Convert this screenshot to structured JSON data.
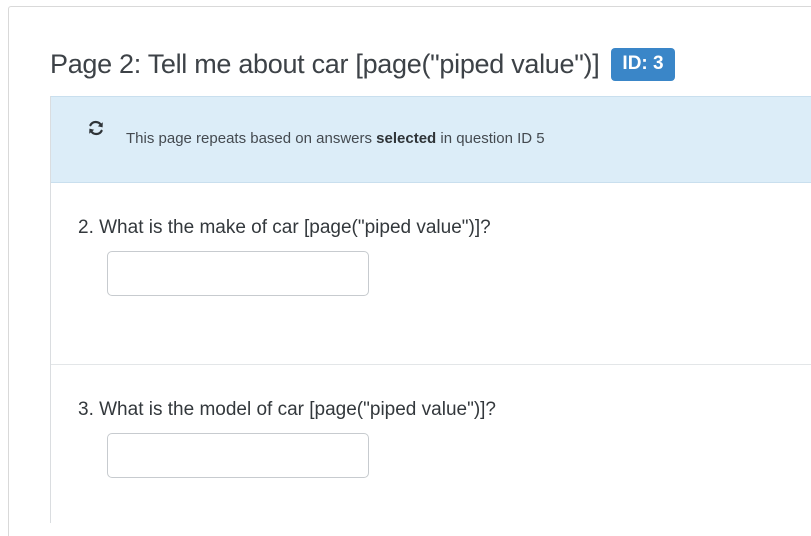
{
  "page": {
    "title": "Page 2: Tell me about car [page(\"piped value\")]",
    "id_badge": "ID: 3"
  },
  "banner": {
    "icon": "repeat-icon",
    "text_before": "This page repeats based on answers ",
    "text_bold": "selected",
    "text_after": " in question ID 5"
  },
  "questions": [
    {
      "label": "2. What is the make of car [page(\"piped value\")]?",
      "value": "",
      "placeholder": ""
    },
    {
      "label": "3. What is the model of car [page(\"piped value\")]?",
      "value": "",
      "placeholder": ""
    }
  ],
  "colors": {
    "badge": "#3a86c8",
    "banner_bg": "#dcedf8",
    "text": "#3d4247"
  }
}
